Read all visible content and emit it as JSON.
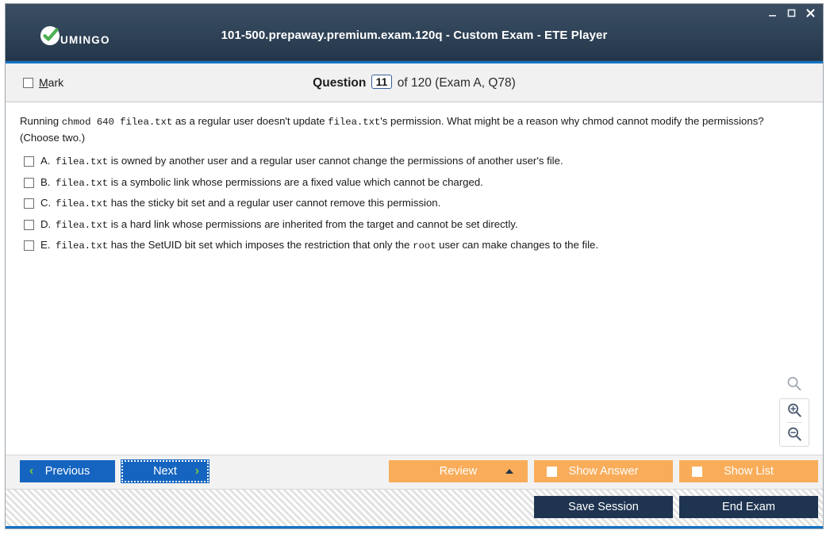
{
  "window": {
    "title": "101-500.prepaway.premium.exam.120q - Custom Exam - ETE Player",
    "logo_text": "UMINGO",
    "controls": {
      "minimize": "–",
      "maximize": "◻",
      "close": "✕"
    },
    "accent_color": "#1472c4",
    "titlebar_color": "#2b3e52"
  },
  "header": {
    "mark_label_prefix": "M",
    "mark_label_rest": "ark",
    "question_word": "Question",
    "question_number": "11",
    "of_text": "of 120 (Exam A, Q78)"
  },
  "question": {
    "parts": [
      {
        "t": "text",
        "v": "Running "
      },
      {
        "t": "code",
        "v": "chmod 640 filea.txt"
      },
      {
        "t": "text",
        "v": " as a regular user doesn't update "
      },
      {
        "t": "code",
        "v": "filea.txt"
      },
      {
        "t": "text",
        "v": "'s permission. What might be a reason why chmod cannot modify the permissions? (Choose two.)"
      }
    ],
    "options": [
      {
        "letter": "A.",
        "parts": [
          {
            "t": "code",
            "v": "filea.txt"
          },
          {
            "t": "text",
            "v": " is owned by another user and a regular user cannot change the permissions of another user's file."
          }
        ],
        "checked": false
      },
      {
        "letter": "B.",
        "parts": [
          {
            "t": "code",
            "v": "filea.txt"
          },
          {
            "t": "text",
            "v": " is a symbolic link whose permissions are a fixed value which cannot be charged."
          }
        ],
        "checked": false
      },
      {
        "letter": "C.",
        "parts": [
          {
            "t": "code",
            "v": "filea.txt"
          },
          {
            "t": "text",
            "v": " has the sticky bit set and a regular user cannot remove this permission."
          }
        ],
        "checked": false
      },
      {
        "letter": "D.",
        "parts": [
          {
            "t": "code",
            "v": "filea.txt"
          },
          {
            "t": "text",
            "v": " is a hard link whose permissions are inherited from the target and cannot be set directly."
          }
        ],
        "checked": false
      },
      {
        "letter": "E.",
        "parts": [
          {
            "t": "code",
            "v": "filea.txt"
          },
          {
            "t": "text",
            "v": " has the SetUID bit set which imposes the restriction that only the "
          },
          {
            "t": "code",
            "v": "root"
          },
          {
            "t": "text",
            "v": " user can make changes to the file."
          }
        ],
        "checked": false
      }
    ]
  },
  "zoom_tools": {
    "search_icon": "search-icon",
    "zoom_in_icon": "zoom-in-icon",
    "zoom_out_icon": "zoom-out-icon"
  },
  "actions": {
    "previous": "Previous",
    "next": "Next",
    "review": "Review",
    "show_answer": "Show Answer",
    "show_list": "Show List",
    "prev_chevron": "‹",
    "next_chevron": "›",
    "orange_color": "#f9ad5a",
    "blue_color": "#1565c0"
  },
  "footer": {
    "save_session": "Save Session",
    "end_exam": "End Exam",
    "dark_color": "#1e3450"
  }
}
